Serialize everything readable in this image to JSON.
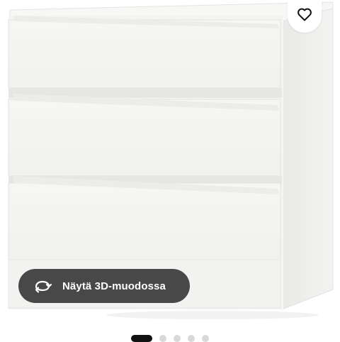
{
  "product": {
    "image_subject": "white-three-drawer-chest"
  },
  "favorite": {
    "icon": "heart-icon"
  },
  "view_3d": {
    "icon": "rotate-3d-icon",
    "label": "Näytä 3D-muodossa"
  },
  "carousel": {
    "total": 5,
    "active_index": 1
  },
  "colors": {
    "button_bg": "#484848",
    "button_text": "#ffffff",
    "dot_active": "#111111",
    "dot_inactive": "#d9d9d9"
  }
}
